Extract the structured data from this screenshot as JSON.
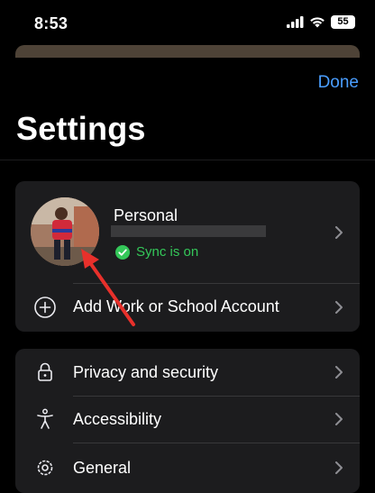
{
  "status_bar": {
    "time": "8:53",
    "battery": "55"
  },
  "header": {
    "done_label": "Done",
    "title": "Settings"
  },
  "account": {
    "name": "Personal",
    "sync_status": "Sync is on",
    "add_account_label": "Add Work or School Account"
  },
  "settings": {
    "items": [
      {
        "label": "Privacy and security",
        "icon": "lock-icon"
      },
      {
        "label": "Accessibility",
        "icon": "accessibility-icon"
      },
      {
        "label": "General",
        "icon": "gear-icon"
      }
    ]
  },
  "colors": {
    "accent": "#4a9eff",
    "sync_green": "#34c759",
    "card_background": "#1c1c1e",
    "annotation_red": "#e8302b"
  }
}
